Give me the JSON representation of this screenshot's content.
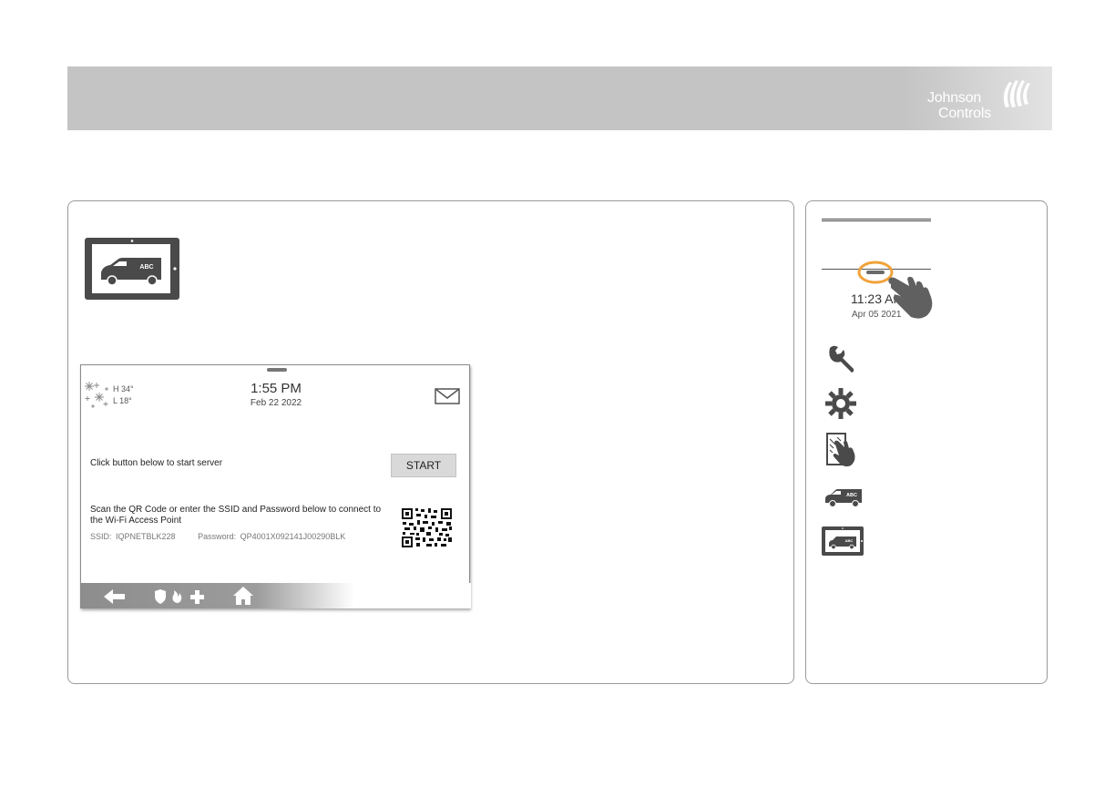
{
  "brand": {
    "line1": "Johnson",
    "line2": "Controls"
  },
  "colors": {
    "header_band": "#c4c4c4",
    "panel_border": "#9a9a9a",
    "tap_ring": "#f0a23a",
    "icon_dark": "#4a4a4a"
  },
  "device_thumbnail": {
    "icon": "device-van-icon",
    "van_label": "ABC"
  },
  "screen": {
    "weather": {
      "icon": "snow-icon",
      "high": "H 34°",
      "low": "L 18°"
    },
    "time": "1:55 PM",
    "date": "Feb 22 2022",
    "message_icon": "mail-icon",
    "server_instruction": "Click button below to start server",
    "start_button": "START",
    "qr_instruction": "Scan the QR Code or enter the SSID and Password below to connect to the Wi-Fi Access Point",
    "ssid_label": "SSID:",
    "ssid_value": "IQPNETBLK228",
    "password_label": "Password:",
    "password_value": "QP4001X092141J00290BLK",
    "nav": [
      "back-arrow-icon",
      "emergency-icons",
      "home-icon"
    ]
  },
  "sidebar": {
    "time": "11:23 AM",
    "date": "Apr 05 2021",
    "icons": [
      "wrench-icon",
      "gear-icon",
      "touch-panel-icon",
      "van-icon",
      "device-van-icon"
    ]
  }
}
